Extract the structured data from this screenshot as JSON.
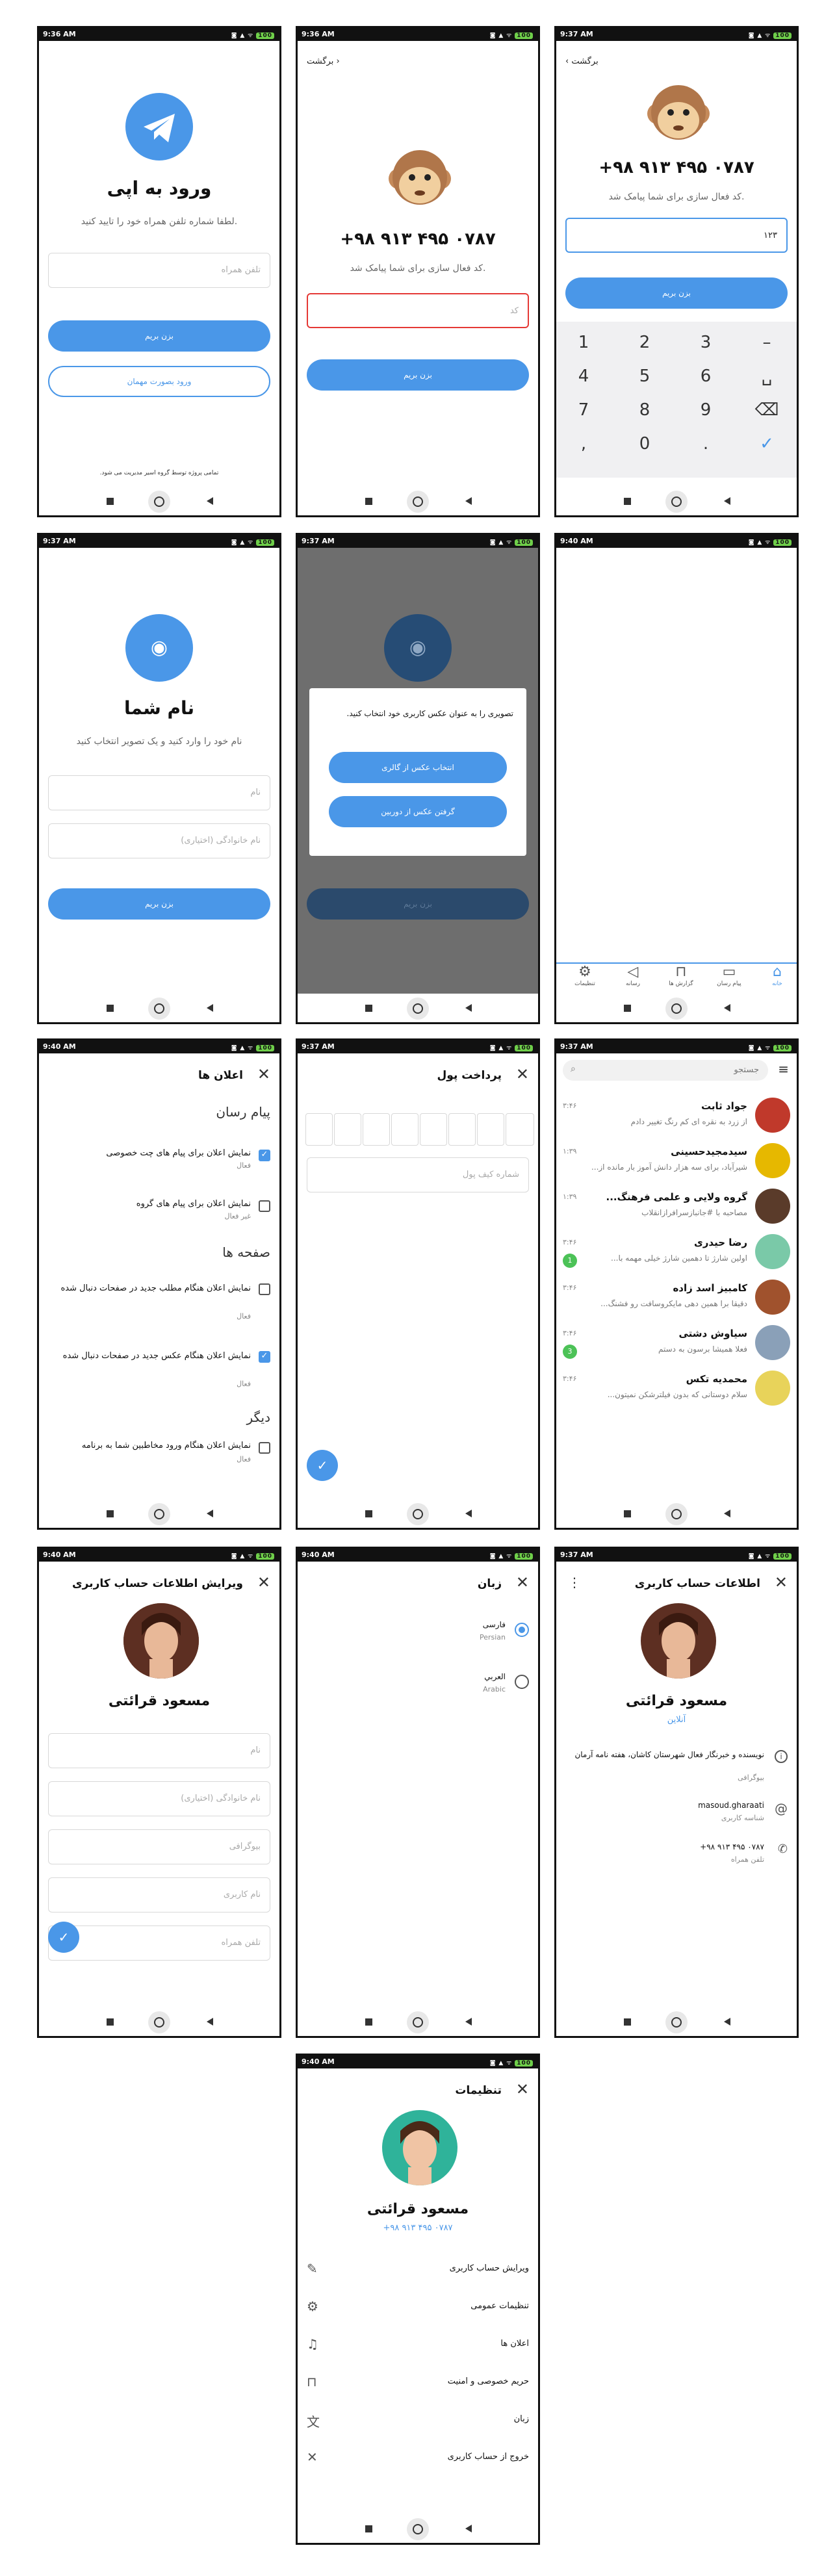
{
  "status": {
    "times": [
      "9:36 AM",
      "9:36 AM",
      "9:37 AM",
      "9:37 AM",
      "9:37 AM",
      "9:40 AM",
      "9:40 AM",
      "9:37 AM",
      "9:37 AM",
      "9:40 AM",
      "9:40 AM",
      "9:37 AM",
      "9:40 AM"
    ],
    "battery": "100"
  },
  "accent": "#4a97e8",
  "login": {
    "title": "ورود به اپی",
    "subtitle": "لطفا شماره تلفن همراه خود را تایید کنید.",
    "phone_placeholder": "تلفن همراه",
    "next": "بزن بریم",
    "guest": "ورود بصورت مهمان",
    "footer": "تمامی پروژه توسط گروه اسیر مدیریت می شود."
  },
  "verify": {
    "back": "برگشت",
    "phone": "+۹۸ ۹۱۳ ۴۹۵ ۰۷۸۷",
    "subtitle": "کد فعال سازی برای شما پیامک شد.",
    "code_placeholder": "کد",
    "next": "بزن بریم"
  },
  "verify2": {
    "back": "برگشت",
    "phone": "+۹۸ ۹۱۳ ۴۹۵ ۰۷۸۷",
    "subtitle": "کد فعال سازی برای شما پیامک شد.",
    "code_value": "۱۲۳",
    "next": "بزن بریم",
    "keys": [
      "1",
      "2",
      "3",
      "–",
      "4",
      "5",
      "6",
      "␣",
      "7",
      "8",
      "9",
      "⌫",
      ",",
      "0",
      ".",
      "✓"
    ]
  },
  "name": {
    "title": "نام شما",
    "subtitle": "نام خود را وارد کنید و یک تصویر انتخاب کنید",
    "first_placeholder": "نام",
    "last_placeholder": "نام خانوادگی (اختیاری)",
    "next": "بزن بریم"
  },
  "photo_dialog": {
    "text": "تصویری را به عنوان عکس کاربری خود انتخاب کنید.",
    "gallery": "انتخاب عکس از گالری",
    "camera": "گرفتن عکس از دوربین",
    "next": "بزن بریم"
  },
  "tabs": [
    {
      "label": "خانه",
      "icon": "home-icon"
    },
    {
      "label": "پیام رسان",
      "icon": "chat-icon"
    },
    {
      "label": "گزارش ها",
      "icon": "lock-icon"
    },
    {
      "label": "رسانه",
      "icon": "megaphone-icon"
    },
    {
      "label": "تنظیمات",
      "icon": "gear-icon"
    }
  ],
  "notifications": {
    "title": "اعلان ها",
    "sec1": "پیام رسان",
    "sec2": "صفحه ها",
    "sec3": "دیگر",
    "items": [
      {
        "title": "نمایش اعلان برای پیام های چت خصوصی",
        "state": "فعال",
        "checked": true
      },
      {
        "title": "نمایش اعلان برای پیام های گروه",
        "state": "غیر فعال",
        "checked": false
      },
      {
        "title": "نمایش اعلان هنگام مطلب جدید در صفحات دنبال شده",
        "state": "فعال",
        "checked": false
      },
      {
        "title": "نمایش اعلان هنگام عکس جدید در صفحات دنبال شده",
        "state": "فعال",
        "checked": true
      },
      {
        "title": "نمایش اعلان هنگام ورود مخاطبین شما به برنامه",
        "state": "فعال",
        "checked": false
      }
    ]
  },
  "payment": {
    "title": "پرداخت پول",
    "wallet_placeholder": "شماره کیف پول"
  },
  "chats": {
    "search": "جستجو",
    "items": [
      {
        "name": "جواد ثابت",
        "msg": "از زرد به نقره ای کم رنگ تغییر دادم",
        "time": "۳:۴۶",
        "badge": "",
        "color": "#c0392b"
      },
      {
        "name": "سیدمجیدحسینی",
        "msg": "شیرآباد، برای سه هزار دانش آموز بار مانده از...",
        "time": "۱:۳۹",
        "badge": "",
        "color": "#e6b800"
      },
      {
        "name": "گروه ولایی و علمی فرهنگ...",
        "msg": "مصاحبه با #جانبازسرافرازانقلاب",
        "time": "۱:۳۹",
        "badge": "",
        "color": "#5a3b2a"
      },
      {
        "name": "رضا حیدری",
        "msg": "اولین شارژ تا دهمین شارژ خیلی مهمه با...",
        "time": "۳:۴۶",
        "badge": "1",
        "color": "#7ac9a8"
      },
      {
        "name": "کامبیز اسد زاده",
        "msg": "دقیقا برا همین دهی مایکروسافت رو فشنگ...",
        "time": "۳:۴۶",
        "badge": "",
        "color": "#a0522d"
      },
      {
        "name": "سیاوش دشتی",
        "msg": "فعلا همیشا برسون به دستم",
        "time": "۳:۴۶",
        "badge": "3",
        "color": "#8aa0b8"
      },
      {
        "name": "محمدیه تکس",
        "msg": "سلام دوستانی که بدون فیلترشکن نمیتون...",
        "time": "۳:۴۶",
        "badge": "",
        "color": "#e8d35a"
      }
    ]
  },
  "edit_profile": {
    "title": "ویرایش اطلاعات حساب کاربری",
    "name": "مسعود قرائتی",
    "fields": [
      "نام",
      "نام خانوادگی (اختیاری)",
      "بیوگرافی",
      "نام کاربری",
      "تلفن همراه"
    ]
  },
  "language": {
    "title": "زبان",
    "options": [
      {
        "name": "فارسی",
        "sub": "Persian",
        "selected": true
      },
      {
        "name": "العربي",
        "sub": "Arabic",
        "selected": false
      }
    ]
  },
  "profile_info": {
    "title": "اطلاعات حساب کاربری",
    "name": "مسعود قرائتی",
    "status": "آنلاین",
    "bio": "نویسنده و خبرنگار فعال شهرستان کاشان، هفته نامه آرمان",
    "bio_label": "بیوگرافی",
    "username": "masoud.gharaati",
    "username_label": "شناسه کاربری",
    "phone": "+۹۸ ۹۱۳ ۴۹۵ ۰۷۸۷",
    "phone_label": "تلفن همراه"
  },
  "settings": {
    "title": "تنظیمات",
    "name": "مسعود قرائتی",
    "phone": "+۹۸ ۹۱۳ ۴۹۵ ۰۷۸۷",
    "items": [
      {
        "label": "ویرایش حساب کاربری",
        "icon": "pencil-icon"
      },
      {
        "label": "تنظیمات عمومی",
        "icon": "gear-icon"
      },
      {
        "label": "اعلان ها",
        "icon": "bell-icon"
      },
      {
        "label": "حریم خصوصی و امنیت",
        "icon": "lock-icon"
      },
      {
        "label": "زبان",
        "icon": "translate-icon"
      },
      {
        "label": "خروج از حساب کاربری",
        "icon": "close-icon"
      }
    ]
  }
}
